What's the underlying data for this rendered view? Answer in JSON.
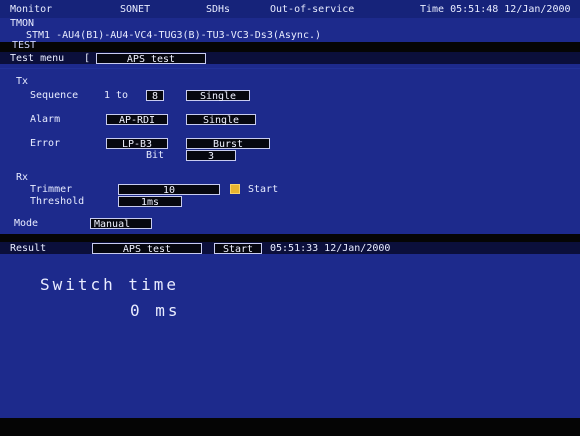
{
  "top": {
    "tabs": [
      "Monitor",
      "SONET",
      "SDHs",
      "Out-of-service"
    ],
    "time": "Time 05:51:48 12/Jan/2000",
    "tag": "TMON",
    "path": "STM1 -AU4(B1)-AU4-VC4-TUG3(B)-TU3-VC3-Ds3(Async.)",
    "label": "TEST"
  },
  "menu": {
    "label": "Test menu",
    "bracket_left": "[",
    "value": "APS test"
  },
  "tx": {
    "heading": "Tx",
    "sequence": {
      "label": "Sequence",
      "range_text": "1 to",
      "value": "8",
      "mode": "Single"
    },
    "alarm": {
      "label": "Alarm",
      "type": "AP-RDI",
      "mode": "Single"
    },
    "error": {
      "label": "Error",
      "type": "LP-B3",
      "mode": "Burst",
      "bit_label": "Bit",
      "bit_value": "3"
    }
  },
  "rx": {
    "heading": "Rx",
    "trimmer": {
      "label": "Trimmer",
      "value": "10",
      "start_label": "Start"
    },
    "threshold": {
      "label": "Threshold",
      "value": "1ms"
    }
  },
  "mode": {
    "label": "Mode",
    "value": "Manual"
  },
  "result": {
    "label": "Result",
    "test": "APS test",
    "start": "Start",
    "timestamp": "05:51:33 12/Jan/2000",
    "switch_label": "Switch time",
    "switch_value": "0 ms"
  }
}
